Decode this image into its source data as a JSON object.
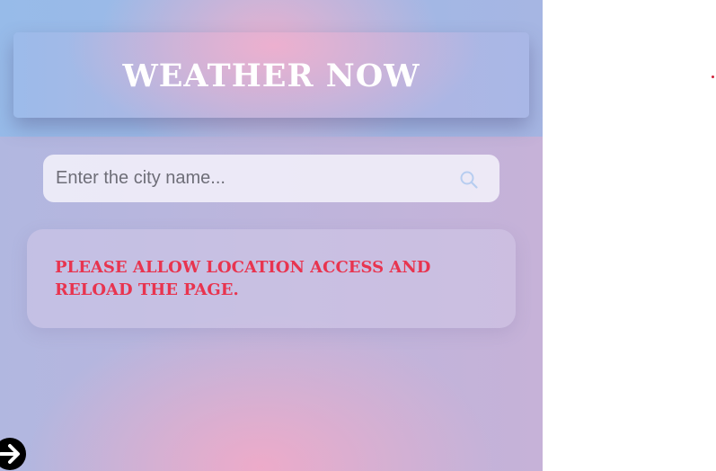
{
  "header": {
    "title": "WEATHER NOW"
  },
  "search": {
    "placeholder": "Enter the city name...",
    "value": "",
    "icon": "search-icon"
  },
  "message": {
    "text": "PLEASE ALLOW LOCATION ACCESS AND RELOAD THE PAGE."
  },
  "nav": {
    "icon": "arrow-right-circle-icon"
  },
  "colors": {
    "title": "#ffffff",
    "message": "#e8344f",
    "accent_blue": "#97bbe9",
    "accent_pink": "#eeb0cd",
    "icon_dark": "#000000"
  }
}
